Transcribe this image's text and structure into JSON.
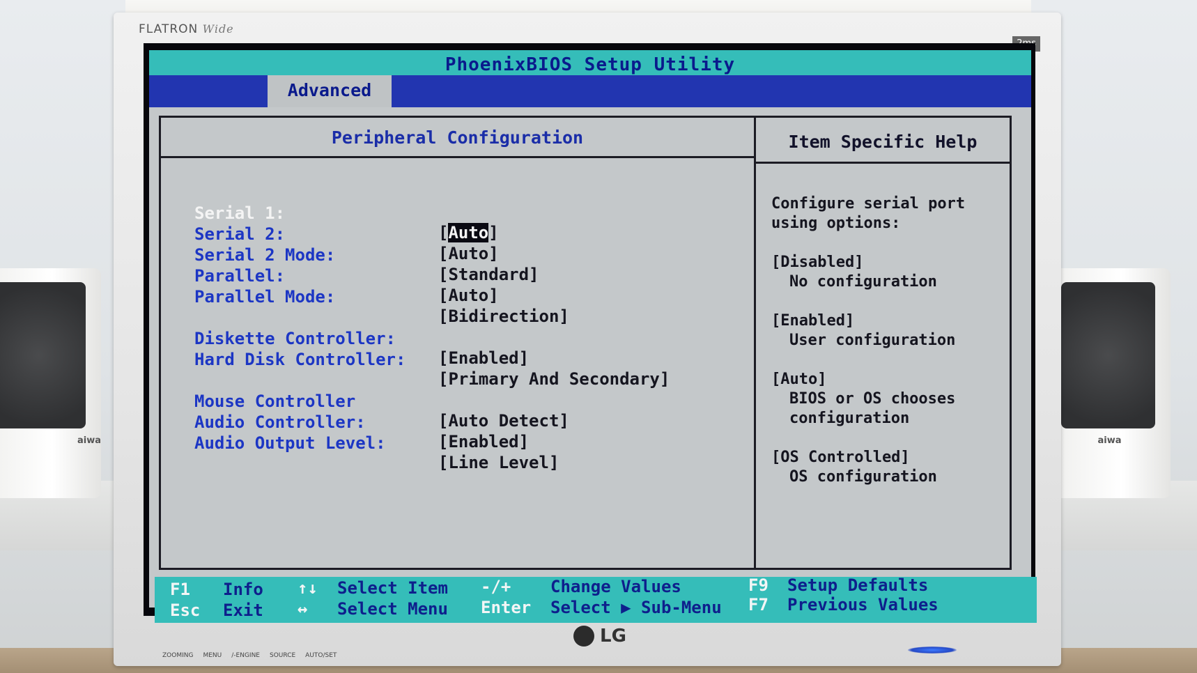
{
  "monitor": {
    "brand": "FLATRON",
    "model_script": "Wide",
    "badges": [
      "2ms"
    ],
    "logo": "LG",
    "buttons": [
      "ZOOMING",
      "MENU",
      "/-ENGINE",
      "SOURCE",
      "AUTO/SET"
    ]
  },
  "speakers": {
    "brand": "aiwa"
  },
  "bios": {
    "title": "PhoenixBIOS Setup Utility",
    "active_tab": "Advanced",
    "panel_title": "Peripheral Configuration",
    "help_title": "Item Specific Help",
    "settings": [
      {
        "label": "Serial 1:",
        "value": "Auto",
        "selected": true
      },
      {
        "label": "Serial 2:",
        "value": "[Auto]"
      },
      {
        "label": "Serial 2 Mode:",
        "value": "[Standard]"
      },
      {
        "label": "Parallel:",
        "value": "[Auto]"
      },
      {
        "label": "Parallel Mode:",
        "value": "[Bidirection]"
      },
      {
        "label": "Diskette Controller:",
        "value": "[Enabled]"
      },
      {
        "label": "Hard Disk Controller:",
        "value": "[Primary And Secondary]"
      },
      {
        "label": "Mouse Controller",
        "value": "[Auto Detect]"
      },
      {
        "label": "Audio Controller:",
        "value": "[Enabled]"
      },
      {
        "label": "Audio Output Level:",
        "value": "[Line Level]"
      }
    ],
    "help": {
      "intro_1": "Configure serial port",
      "intro_2": "using options:",
      "options": [
        {
          "name": "[Disabled]",
          "desc": [
            "No configuration"
          ]
        },
        {
          "name": "[Enabled]",
          "desc": [
            "User configuration"
          ]
        },
        {
          "name": "[Auto]",
          "desc": [
            "BIOS or OS chooses",
            "configuration"
          ]
        },
        {
          "name": "[OS Controlled]",
          "desc": [
            "OS configuration"
          ]
        }
      ]
    },
    "footer": {
      "f1_key": "F1",
      "f1_label": "Info",
      "esc_key": "Esc",
      "esc_label": "Exit",
      "updown_key": "↑↓",
      "updown_label": "Select Item",
      "leftright_key": "↔",
      "leftright_label": "Select Menu",
      "plusminus_key": "-/+",
      "plusminus_label": "Change Values",
      "enter_key": "Enter",
      "enter_label": "Select ▶ Sub-Menu",
      "f9_key": "F9",
      "f9_label": "Setup Defaults",
      "f7_key": "F7",
      "f7_label": "Previous Values"
    }
  }
}
